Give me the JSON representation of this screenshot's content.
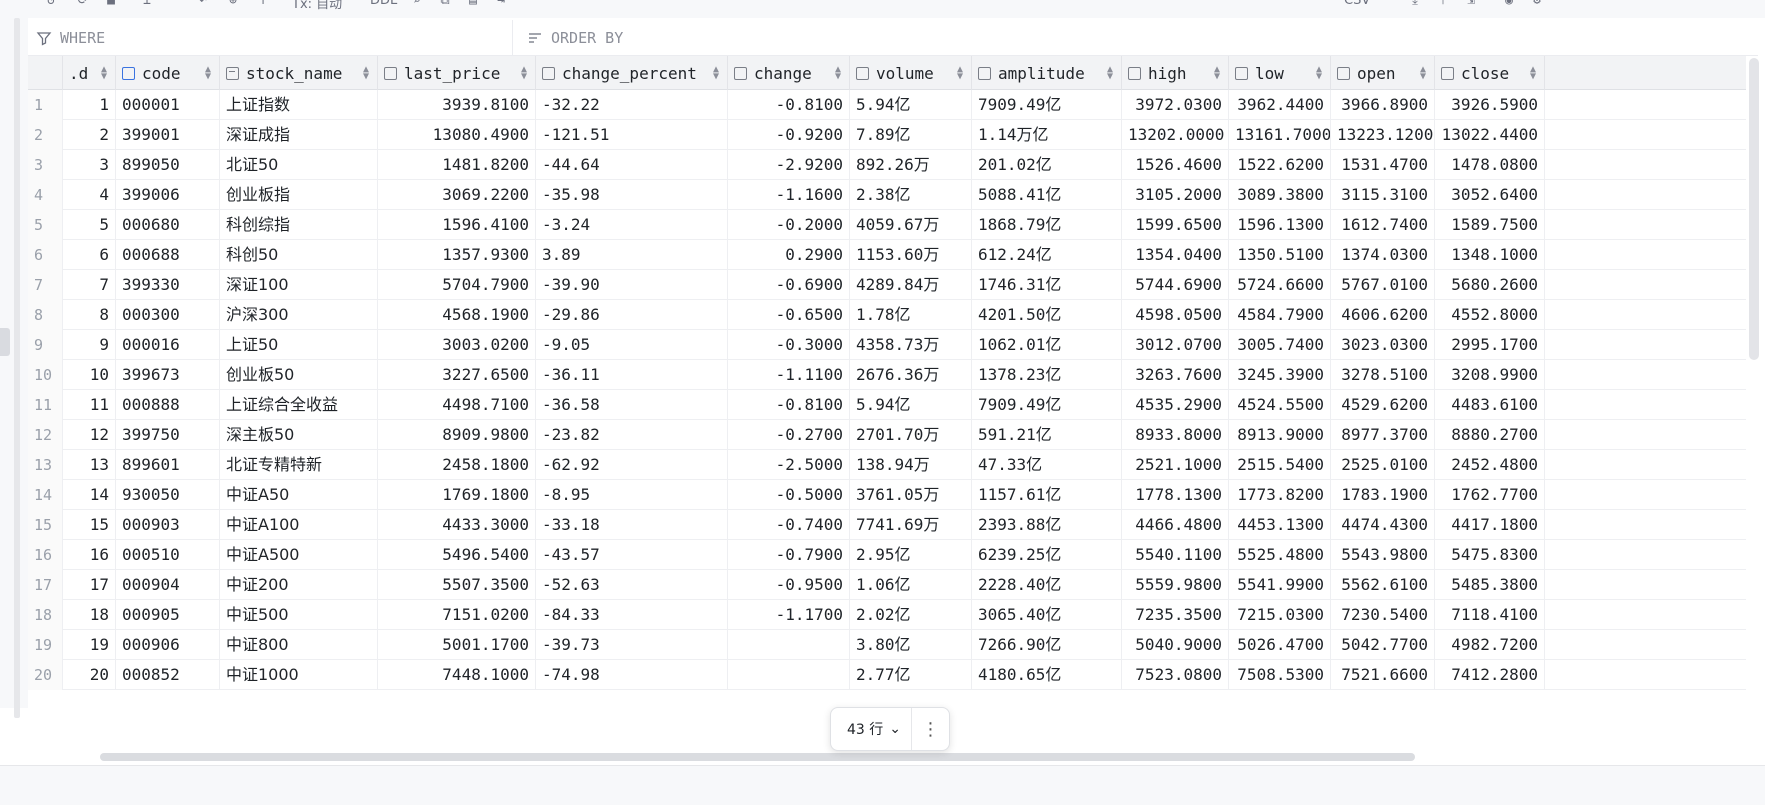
{
  "toolbar": {
    "tx_mode": "Tx: 自动",
    "ddl": "DDL",
    "format": "CSV"
  },
  "filter": {
    "where_placeholder": "WHERE",
    "order_placeholder": "ORDER BY"
  },
  "columns": [
    {
      "label": "id",
      "shown": ".d",
      "icon": "key-column-icon"
    },
    {
      "label": "code",
      "icon": "key-column-icon"
    },
    {
      "label": "stock_name",
      "icon": "string-column-icon"
    },
    {
      "label": "last_price",
      "icon": "column-icon"
    },
    {
      "label": "change_percent",
      "icon": "column-icon"
    },
    {
      "label": "change",
      "icon": "column-icon"
    },
    {
      "label": "volume",
      "icon": "column-icon"
    },
    {
      "label": "amplitude",
      "icon": "column-icon"
    },
    {
      "label": "high",
      "icon": "column-icon"
    },
    {
      "label": "low",
      "icon": "column-icon"
    },
    {
      "label": "open",
      "icon": "column-icon"
    },
    {
      "label": "close",
      "icon": "column-icon"
    }
  ],
  "rows": [
    [
      "1",
      "1",
      "000001",
      "上证指数",
      "3939.8100",
      "-32.22",
      "-0.8100",
      "5.94亿",
      "7909.49亿",
      "3972.0300",
      "3962.4400",
      "3966.8900",
      "3926.5900"
    ],
    [
      "2",
      "2",
      "399001",
      "深证成指",
      "13080.4900",
      "-121.51",
      "-0.9200",
      "7.89亿",
      "1.14万亿",
      "13202.0000",
      "13161.7000",
      "13223.1200",
      "13022.4400"
    ],
    [
      "3",
      "3",
      "899050",
      "北证50",
      "1481.8200",
      "-44.64",
      "-2.9200",
      "892.26万",
      "201.02亿",
      "1526.4600",
      "1522.6200",
      "1531.4700",
      "1478.0800"
    ],
    [
      "4",
      "4",
      "399006",
      "创业板指",
      "3069.2200",
      "-35.98",
      "-1.1600",
      "2.38亿",
      "5088.41亿",
      "3105.2000",
      "3089.3800",
      "3115.3100",
      "3052.6400"
    ],
    [
      "5",
      "5",
      "000680",
      "科创综指",
      "1596.4100",
      "-3.24",
      "-0.2000",
      "4059.67万",
      "1868.79亿",
      "1599.6500",
      "1596.1300",
      "1612.7400",
      "1589.7500"
    ],
    [
      "6",
      "6",
      "000688",
      "科创50",
      "1357.9300",
      "3.89",
      "0.2900",
      "1153.60万",
      "612.24亿",
      "1354.0400",
      "1350.5100",
      "1374.0300",
      "1348.1000"
    ],
    [
      "7",
      "7",
      "399330",
      "深证100",
      "5704.7900",
      "-39.90",
      "-0.6900",
      "4289.84万",
      "1746.31亿",
      "5744.6900",
      "5724.6600",
      "5767.0100",
      "5680.2600"
    ],
    [
      "8",
      "8",
      "000300",
      "沪深300",
      "4568.1900",
      "-29.86",
      "-0.6500",
      "1.78亿",
      "4201.50亿",
      "4598.0500",
      "4584.7900",
      "4606.6200",
      "4552.8000"
    ],
    [
      "9",
      "9",
      "000016",
      "上证50",
      "3003.0200",
      "-9.05",
      "-0.3000",
      "4358.73万",
      "1062.01亿",
      "3012.0700",
      "3005.7400",
      "3023.0300",
      "2995.1700"
    ],
    [
      "10",
      "10",
      "399673",
      "创业板50",
      "3227.6500",
      "-36.11",
      "-1.1100",
      "2676.36万",
      "1378.23亿",
      "3263.7600",
      "3245.3900",
      "3278.5100",
      "3208.9900"
    ],
    [
      "11",
      "11",
      "000888",
      "上证综合全收益",
      "4498.7100",
      "-36.58",
      "-0.8100",
      "5.94亿",
      "7909.49亿",
      "4535.2900",
      "4524.5500",
      "4529.6200",
      "4483.6100"
    ],
    [
      "12",
      "12",
      "399750",
      "深主板50",
      "8909.9800",
      "-23.82",
      "-0.2700",
      "2701.70万",
      "591.21亿",
      "8933.8000",
      "8913.9000",
      "8977.3700",
      "8880.2700"
    ],
    [
      "13",
      "13",
      "899601",
      "北证专精特新",
      "2458.1800",
      "-62.92",
      "-2.5000",
      "138.94万",
      "47.33亿",
      "2521.1000",
      "2515.5400",
      "2525.0100",
      "2452.4800"
    ],
    [
      "14",
      "14",
      "930050",
      "中证A50",
      "1769.1800",
      "-8.95",
      "-0.5000",
      "3761.05万",
      "1157.61亿",
      "1778.1300",
      "1773.8200",
      "1783.1900",
      "1762.7700"
    ],
    [
      "15",
      "15",
      "000903",
      "中证A100",
      "4433.3000",
      "-33.18",
      "-0.7400",
      "7741.69万",
      "2393.88亿",
      "4466.4800",
      "4453.1300",
      "4474.4300",
      "4417.1800"
    ],
    [
      "16",
      "16",
      "000510",
      "中证A500",
      "5496.5400",
      "-43.57",
      "-0.7900",
      "2.95亿",
      "6239.25亿",
      "5540.1100",
      "5525.4800",
      "5543.9800",
      "5475.8300"
    ],
    [
      "17",
      "17",
      "000904",
      "中证200",
      "5507.3500",
      "-52.63",
      "-0.9500",
      "1.06亿",
      "2228.40亿",
      "5559.9800",
      "5541.9900",
      "5562.6100",
      "5485.3800"
    ],
    [
      "18",
      "18",
      "000905",
      "中证500",
      "7151.0200",
      "-84.33",
      "-1.1700",
      "2.02亿",
      "3065.40亿",
      "7235.3500",
      "7215.0300",
      "7230.5400",
      "7118.4100"
    ],
    [
      "19",
      "19",
      "000906",
      "中证800",
      "5001.1700",
      "-39.73",
      "",
      "3.80亿",
      "7266.90亿",
      "5040.9000",
      "5026.4700",
      "5042.7700",
      "4982.7200"
    ],
    [
      "20",
      "20",
      "000852",
      "中证1000",
      "7448.1000",
      "-74.98",
      "",
      "2.77亿",
      "4180.65亿",
      "7523.0800",
      "7508.5300",
      "7521.6600",
      "7412.2800"
    ]
  ],
  "footer": {
    "row_count": "43 行"
  }
}
